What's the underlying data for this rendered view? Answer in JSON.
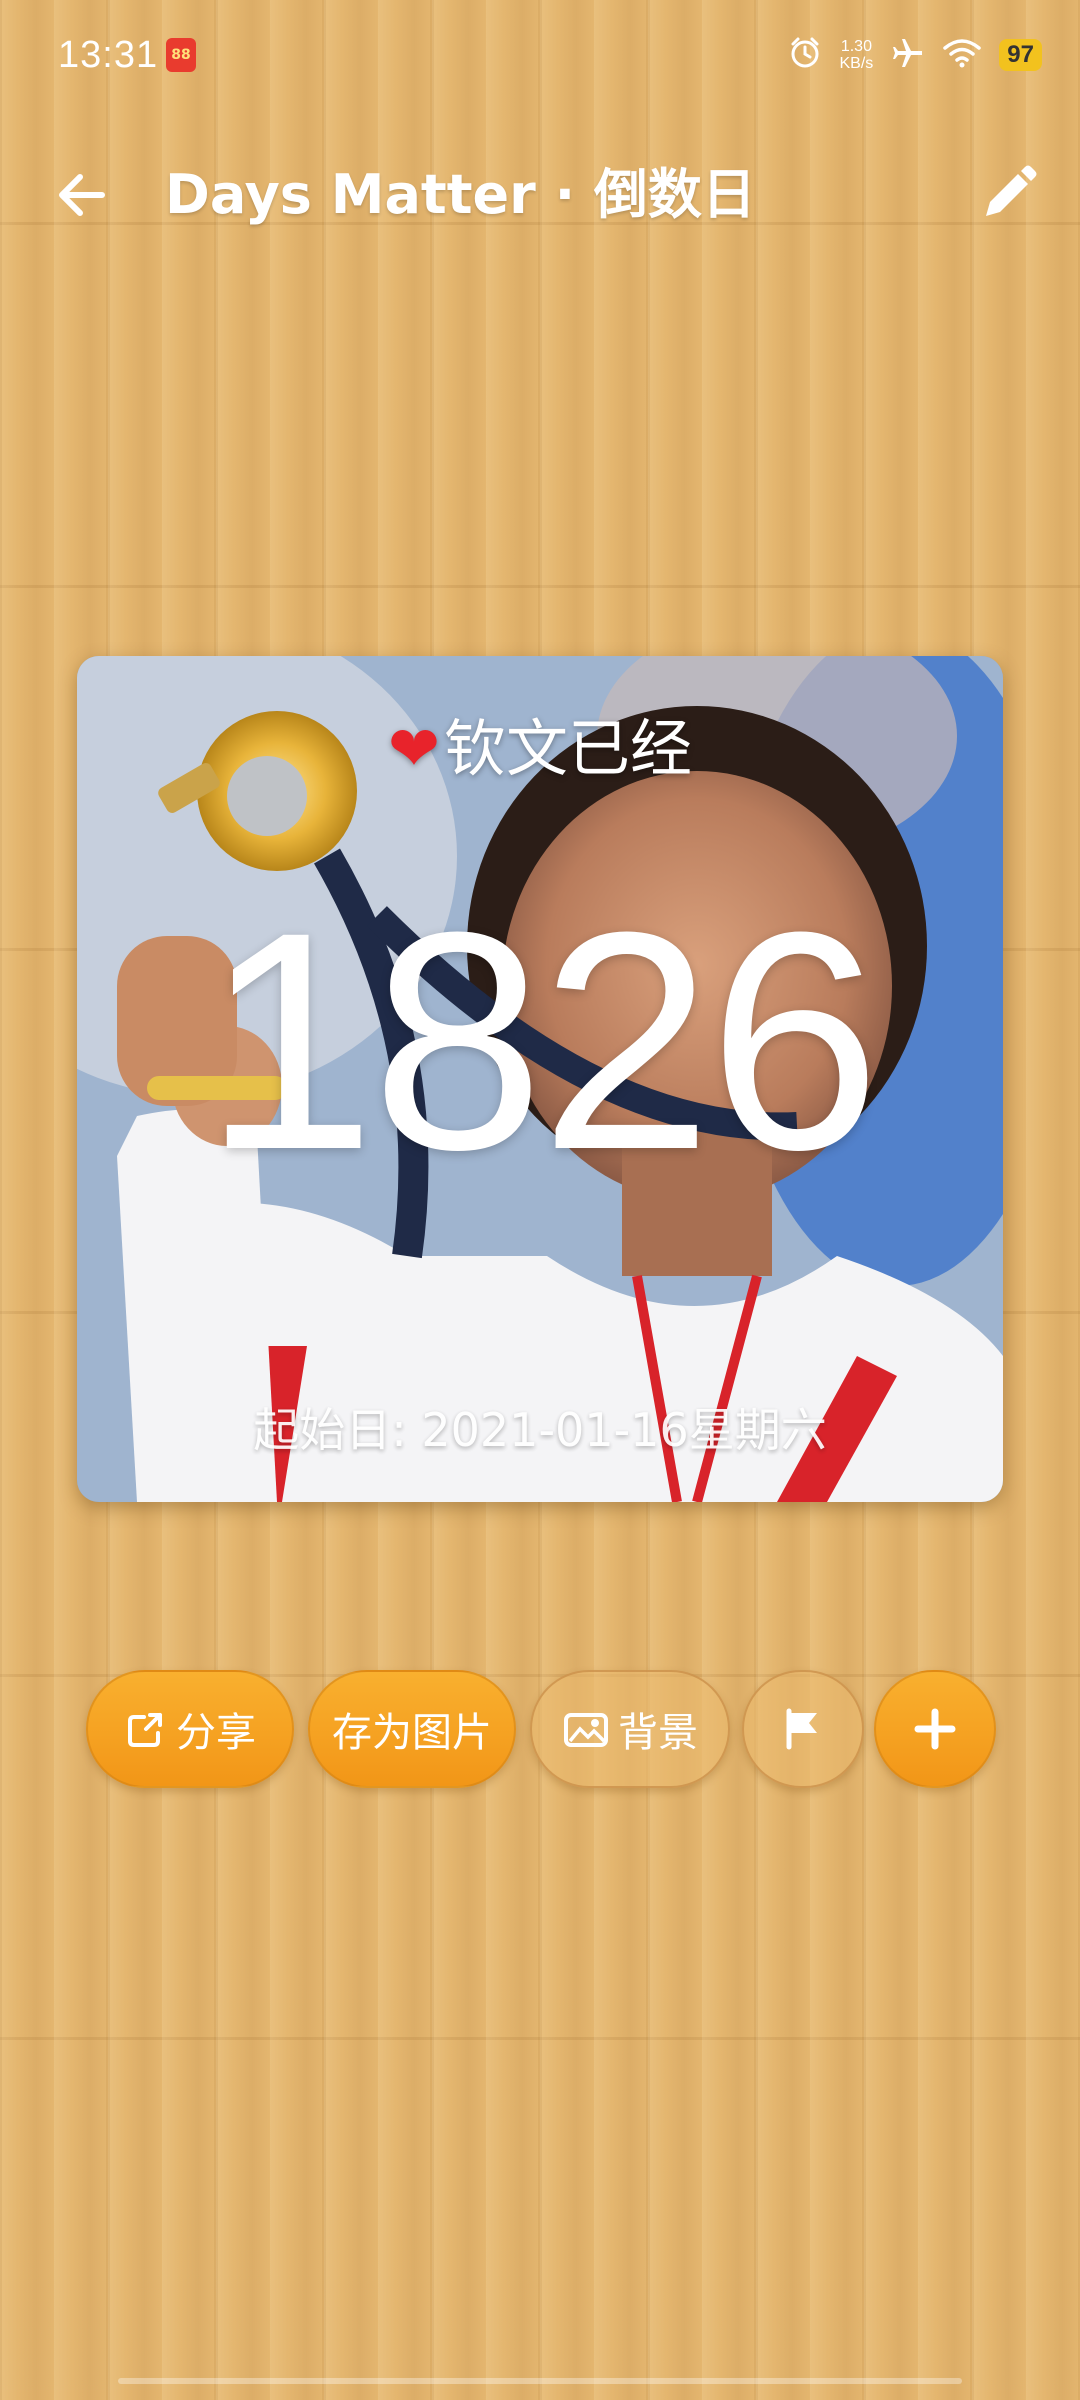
{
  "status_bar": {
    "time": "13:31",
    "network_speed_value": "1.30",
    "network_speed_unit": "KB/s",
    "battery": "97",
    "icons": [
      "alarm-icon",
      "airplane-mode-icon",
      "wifi-icon",
      "battery-icon"
    ]
  },
  "header": {
    "title": "Days Matter · 倒数日"
  },
  "card": {
    "title": "钦文已经",
    "count": "1826",
    "start_date": "起始日: 2021-01-16星期六"
  },
  "actions": {
    "share_label": "分享",
    "save_image_label": "存为图片",
    "background_label": "背景"
  },
  "colors": {
    "accent": "#f5a623",
    "text": "#ffffff",
    "wood": "#e4b66f",
    "heart": "#e8232b"
  }
}
